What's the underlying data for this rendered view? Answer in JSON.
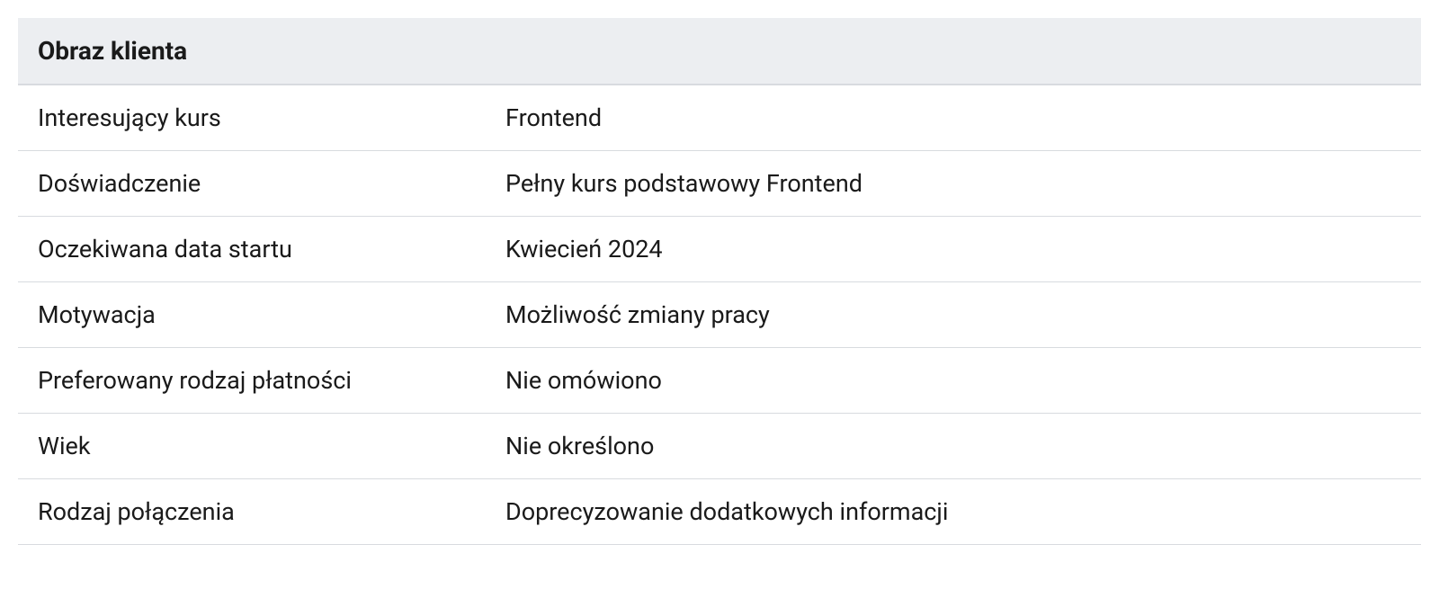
{
  "table": {
    "header": "Obraz klienta",
    "rows": [
      {
        "label": "Interesujący kurs",
        "value": "Frontend"
      },
      {
        "label": "Doświadczenie",
        "value": "Pełny kurs podstawowy Frontend"
      },
      {
        "label": "Oczekiwana data startu",
        "value": "Kwiecień 2024"
      },
      {
        "label": "Motywacja",
        "value": "Możliwość zmiany pracy"
      },
      {
        "label": "Preferowany rodzaj płatności",
        "value": "Nie omówiono"
      },
      {
        "label": "Wiek",
        "value": "Nie określono"
      },
      {
        "label": "Rodzaj połączenia",
        "value": "Doprecyzowanie dodatkowych informacji"
      }
    ]
  }
}
